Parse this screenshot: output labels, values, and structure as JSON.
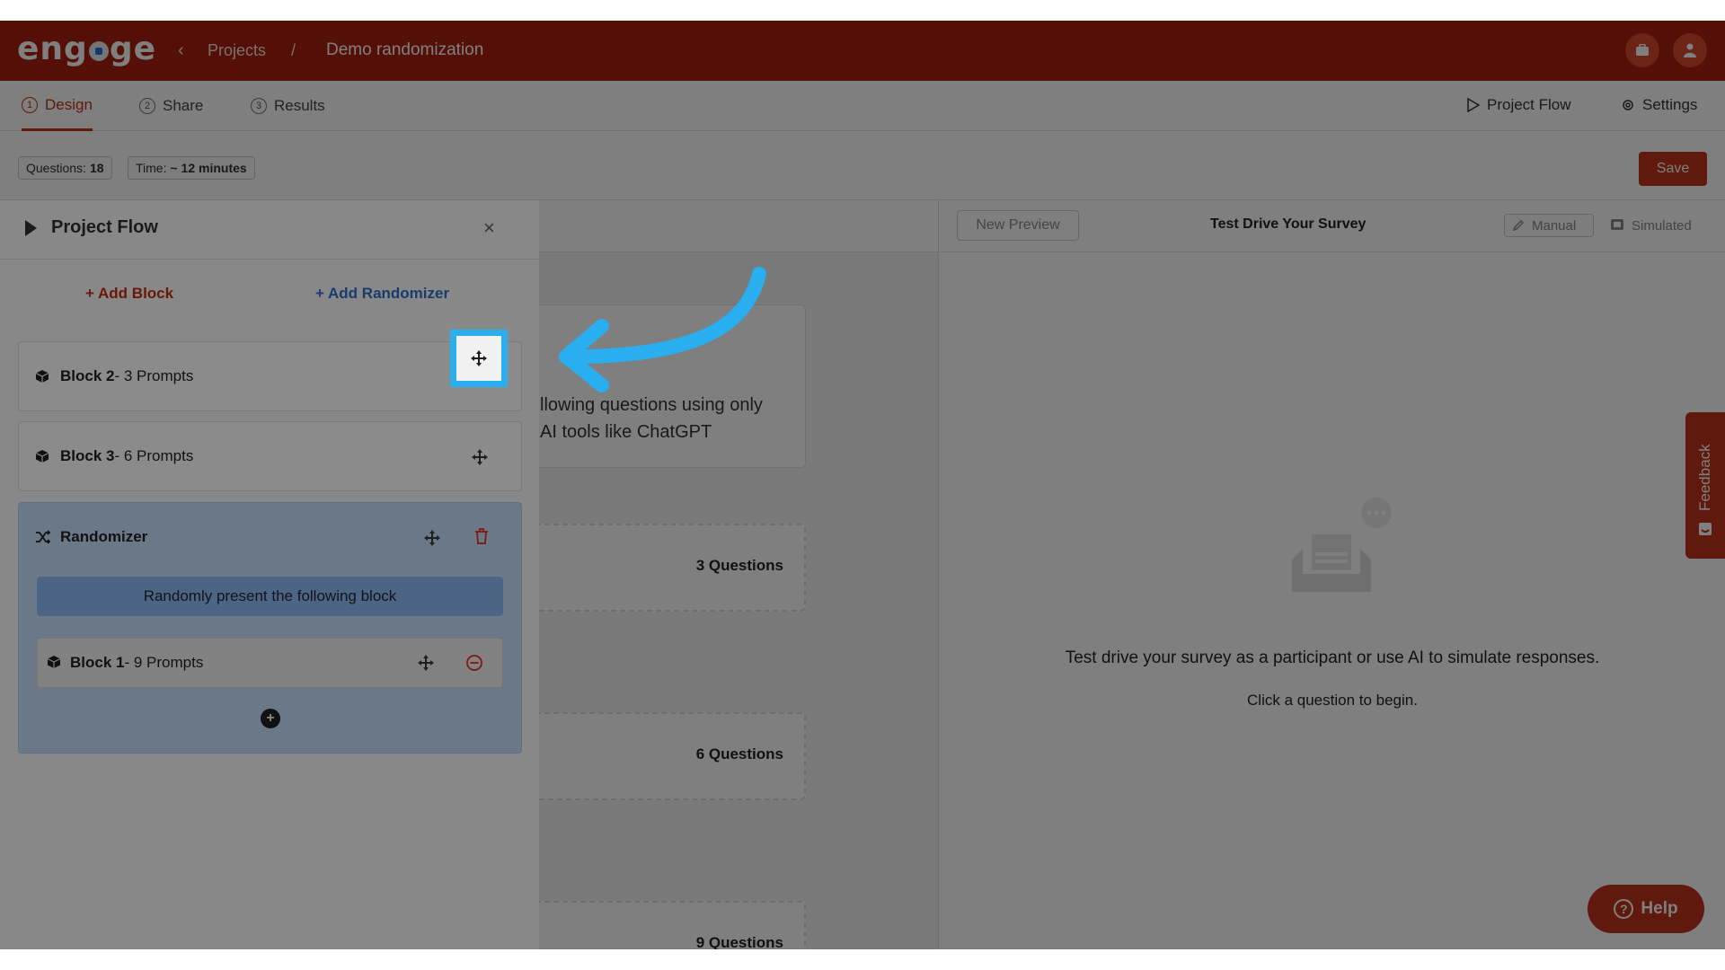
{
  "header": {
    "logo_text": "engage",
    "breadcrumb_back": "‹",
    "breadcrumb_projects": "Projects",
    "breadcrumb_sep": "/",
    "breadcrumb_title": "Demo randomization",
    "icons": [
      "briefcase-icon",
      "user-icon"
    ]
  },
  "tabs": [
    {
      "num": "1",
      "label": "Design",
      "active": true
    },
    {
      "num": "2",
      "label": "Share",
      "active": false
    },
    {
      "num": "3",
      "label": "Results",
      "active": false
    }
  ],
  "right_links": {
    "project_flow": "Project Flow",
    "settings": "Settings"
  },
  "stats": {
    "questions_label": "Questions:",
    "questions_value": "18",
    "time_label": "Time:",
    "time_value": "~ 12 minutes",
    "save_label": "Save"
  },
  "drawer": {
    "title": "Project Flow",
    "close": "×",
    "add_block": "+ Add Block",
    "add_randomizer": "+ Add Randomizer",
    "blocks": [
      {
        "name": "Block 2",
        "suffix": "- 3 Prompts"
      },
      {
        "name": "Block 3",
        "suffix": "- 6 Prompts"
      }
    ],
    "randomizer": {
      "title": "Randomizer",
      "banner": "Randomly present the following block",
      "inner_block_name": "Block 1",
      "inner_block_suffix": "- 9 Prompts",
      "add": "+"
    }
  },
  "canvas": {
    "intro_text": "llowing questions using only\nAI tools like ChatGPT",
    "cards": [
      {
        "count": "3 Questions"
      },
      {
        "count": "6 Questions"
      },
      {
        "count": "9 Questions"
      }
    ]
  },
  "preview": {
    "new_preview": "New Preview",
    "title": "Test Drive Your Survey",
    "manual": "Manual",
    "simulated": "Simulated",
    "empty_main": "Test drive your survey as a participant or use AI to simulate responses.",
    "empty_sub": "Click a question to begin."
  },
  "feedback": "Feedback",
  "help": "Help",
  "colors": {
    "brand": "#c0321b",
    "highlight": "#29aef0",
    "randomizer": "#6a7888"
  }
}
